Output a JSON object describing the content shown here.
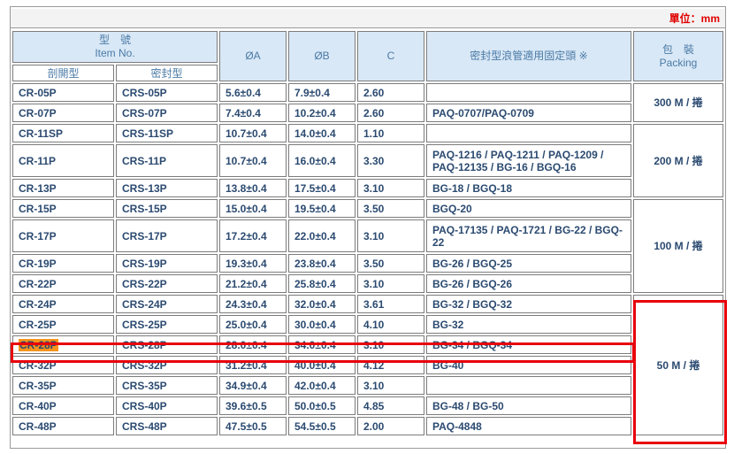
{
  "unit_label": "單位：mm",
  "headers": {
    "item_no_zh": "型　號",
    "item_no_en": "Item No.",
    "open_type": "剖開型",
    "sealed_type": "密封型",
    "dia_a": "ØA",
    "dia_b": "ØB",
    "c": "C",
    "fitting": "密封型浪管適用固定頭 ※",
    "packing_zh": "包　裝",
    "packing_en": "Packing"
  },
  "rows": [
    {
      "open": "CR-05P",
      "sealed": "CRS-05P",
      "a": "5.6±0.4",
      "b": "7.9±0.4",
      "c": "2.60",
      "fit": ""
    },
    {
      "open": "CR-07P",
      "sealed": "CRS-07P",
      "a": "7.4±0.4",
      "b": "10.2±0.4",
      "c": "2.60",
      "fit": "PAQ-0707/PAQ-0709"
    },
    {
      "open": "CR-11SP",
      "sealed": "CRS-11SP",
      "a": "10.7±0.4",
      "b": "14.0±0.4",
      "c": "1.10",
      "fit": ""
    },
    {
      "open": "CR-11P",
      "sealed": "CRS-11P",
      "a": "10.7±0.4",
      "b": "16.0±0.4",
      "c": "3.30",
      "fit": "PAQ-1216 / PAQ-1211 / PAQ-1209 / PAQ-12135 / BG-16 / BGQ-16"
    },
    {
      "open": "CR-13P",
      "sealed": "CRS-13P",
      "a": "13.8±0.4",
      "b": "17.5±0.4",
      "c": "3.10",
      "fit": "BG-18 / BGQ-18"
    },
    {
      "open": "CR-15P",
      "sealed": "CRS-15P",
      "a": "15.0±0.4",
      "b": "19.5±0.4",
      "c": "3.50",
      "fit": "BGQ-20"
    },
    {
      "open": "CR-17P",
      "sealed": "CRS-17P",
      "a": "17.2±0.4",
      "b": "22.0±0.4",
      "c": "3.10",
      "fit": "PAQ-17135 / PAQ-1721 / BG-22 / BGQ-22"
    },
    {
      "open": "CR-19P",
      "sealed": "CRS-19P",
      "a": "19.3±0.4",
      "b": "23.8±0.4",
      "c": "3.50",
      "fit": "BG-26 / BGQ-25"
    },
    {
      "open": "CR-22P",
      "sealed": "CRS-22P",
      "a": "21.2±0.4",
      "b": "25.8±0.4",
      "c": "3.10",
      "fit": "BG-26 / BGQ-26"
    },
    {
      "open": "CR-24P",
      "sealed": "CRS-24P",
      "a": "24.3±0.4",
      "b": "32.0±0.4",
      "c": "3.61",
      "fit": "BG-32 / BGQ-32"
    },
    {
      "open": "CR-25P",
      "sealed": "CRS-25P",
      "a": "25.0±0.4",
      "b": "30.0±0.4",
      "c": "4.10",
      "fit": "BG-32"
    },
    {
      "open": "CR-28P",
      "sealed": "CRS-28P",
      "a": "28.0±0.4",
      "b": "34.0±0.4",
      "c": "3.10",
      "fit": "BG-34 / BGQ-34"
    },
    {
      "open": "CR-32P",
      "sealed": "CRS-32P",
      "a": "31.2±0.4",
      "b": "40.0±0.4",
      "c": "4.12",
      "fit": "BG-40"
    },
    {
      "open": "CR-35P",
      "sealed": "CRS-35P",
      "a": "34.9±0.4",
      "b": "42.0±0.4",
      "c": "3.10",
      "fit": ""
    },
    {
      "open": "CR-40P",
      "sealed": "CRS-40P",
      "a": "39.6±0.5",
      "b": "50.0±0.5",
      "c": "4.85",
      "fit": "BG-48 / BG-50"
    },
    {
      "open": "CR-48P",
      "sealed": "CRS-48P",
      "a": "47.5±0.5",
      "b": "54.5±0.5",
      "c": "2.00",
      "fit": "PAQ-4848"
    }
  ],
  "packing": {
    "p300": "300 M / 捲",
    "p200": "200 M / 捲",
    "p100": "100 M / 捲",
    "p50": "50 M / 捲"
  },
  "colors": {
    "header_bg": "#d9e8f6",
    "header_text": "#4a7aa6",
    "body_text": "#2b4a70",
    "unit_text": "#e00000",
    "highlight_border": "#e8000a",
    "highlight_fill": "#f7941d"
  }
}
